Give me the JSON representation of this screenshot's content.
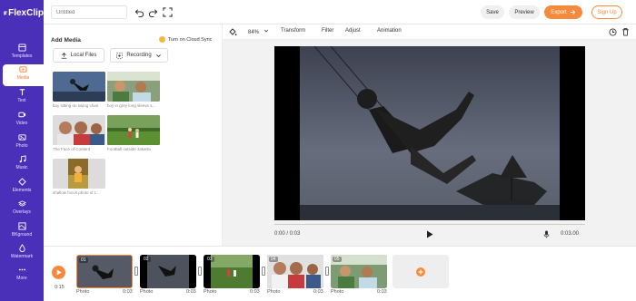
{
  "app": {
    "logo_text": "FlexClip"
  },
  "sidebar": {
    "items": [
      {
        "label": "Templates",
        "icon": "templates-icon"
      },
      {
        "label": "Media",
        "icon": "media-icon",
        "active": true
      },
      {
        "label": "Text",
        "icon": "text-icon"
      },
      {
        "label": "Video",
        "icon": "video-icon"
      },
      {
        "label": "Photo",
        "icon": "photo-icon"
      },
      {
        "label": "Music",
        "icon": "music-icon"
      },
      {
        "label": "Elements",
        "icon": "elements-icon"
      },
      {
        "label": "Overlays",
        "icon": "overlays-icon"
      },
      {
        "label": "BKground",
        "icon": "background-icon"
      },
      {
        "label": "Watermark",
        "icon": "watermark-icon"
      },
      {
        "label": "More",
        "icon": "more-icon"
      }
    ]
  },
  "topbar": {
    "title_placeholder": "Untitled",
    "save_label": "Save",
    "preview_label": "Preview",
    "export_label": "Export",
    "signup_label": "Sign Up"
  },
  "media_panel": {
    "title": "Add Media",
    "cloud_sync_label": "Turn on Cloud Sync",
    "local_files_label": "Local Files",
    "recording_label": "Recording",
    "items": [
      {
        "caption": "boy sitting on swing chair"
      },
      {
        "caption": "boy in grey long sleeve s..."
      },
      {
        "caption": "The Face of Content"
      },
      {
        "caption": "Football outside Jakarta"
      },
      {
        "caption": "shallow focus photo of t..."
      }
    ]
  },
  "edit_toolbar": {
    "zoom": "84%",
    "transform_label": "Transform",
    "filter_label": "Filter",
    "adjust_label": "Adjust",
    "animation_label": "Animation"
  },
  "player": {
    "current_time": "0:00 / 0:03",
    "clip_time": "0:03.00"
  },
  "timeline": {
    "total_time": "0:15",
    "clips": [
      {
        "num": "01",
        "label": "Photo",
        "duration": "0:03",
        "selected": true
      },
      {
        "num": "02",
        "label": "Photo",
        "duration": "0:03"
      },
      {
        "num": "03",
        "label": "Photo",
        "duration": "0:03"
      },
      {
        "num": "04",
        "label": "Photo",
        "duration": "0:03"
      },
      {
        "num": "05",
        "label": "Photo",
        "duration": "0:03"
      }
    ]
  },
  "colors": {
    "accent": "#f58a3d",
    "sidebar": "#4a2fb8"
  }
}
